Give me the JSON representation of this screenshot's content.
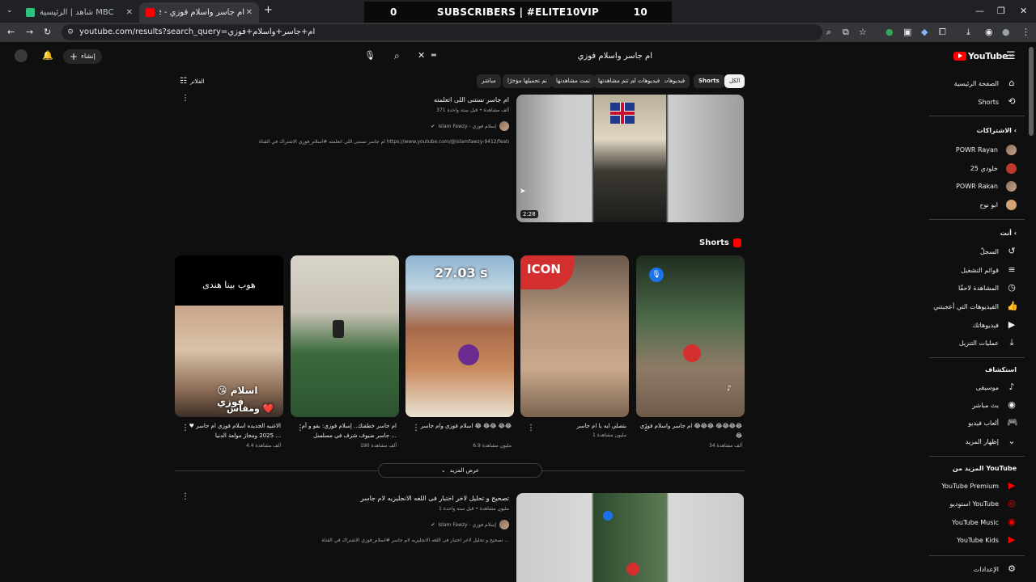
{
  "browser": {
    "tabs": [
      {
        "label": "شاهد | الرئيسية MBC",
        "active": false
      },
      {
        "label": "ام جاسر واسلام فوزي - YouTube",
        "active": true
      }
    ],
    "new_tab": "+",
    "overlay_banner": {
      "left_number": "0",
      "text": "SUBSCRIBERS | #ELITE10VIP",
      "right_number": "10"
    },
    "url": "youtube.com/results?search_query=ام+جاسر+واسلام+فوزي"
  },
  "masthead": {
    "logo_text": "YouTube",
    "logo_region": "SA",
    "search_value": "ام جاسر واسلام فوزي",
    "create_label": "إنشاء"
  },
  "sidebar": {
    "primary": [
      {
        "label": "الصفحة الرئيسية",
        "icon": "home-icon"
      },
      {
        "label": "Shorts",
        "icon": "shorts-icon"
      }
    ],
    "subscriptions_heading": "الاشتراكات",
    "subscriptions": [
      "POWR Rayan",
      "خلودي 25",
      "POWR Rakan",
      "ابو نوح"
    ],
    "you_heading": "أنت",
    "you_items": [
      {
        "label": "السجلّ",
        "icon": "history-icon"
      },
      {
        "label": "قوائم التشغيل",
        "icon": "playlist-icon"
      },
      {
        "label": "المشاهدة لاحقًا",
        "icon": "clock-icon"
      },
      {
        "label": "الفيديوهات التي أعجبتني",
        "icon": "like-icon"
      },
      {
        "label": "فيديوهاتك",
        "icon": "video-icon"
      },
      {
        "label": "عمليات التنزيل",
        "icon": "download-icon"
      }
    ],
    "explore_heading": "استكشاف",
    "explore_items": [
      {
        "label": "موسيقى",
        "icon": "music-icon"
      },
      {
        "label": "بث مباشر",
        "icon": "live-icon"
      },
      {
        "label": "ألعاب فيديو",
        "icon": "gaming-icon"
      },
      {
        "label": "إظهار المزيد",
        "icon": "chevron-down-icon"
      }
    ],
    "more_heading": "المزيد من YouTube",
    "more_items": [
      "YouTube Premium",
      "استوديو YouTube",
      "YouTube Music",
      "YouTube Kids"
    ],
    "settings_label": "الإعدادات"
  },
  "filters": {
    "label": "الفلاتر",
    "chips": [
      "الكل",
      "Shorts",
      "فيديوهات",
      "فيديوهات لم تتم مشاهدتها",
      "تمت مشاهدتها",
      "تم تحميلها مؤخرًا",
      "مباشر"
    ]
  },
  "video1": {
    "title": "ام جاسر نستنى اللى اتعلمته",
    "meta": "371 ألف مشاهدة • قبل سنة واحدة",
    "channel": "Islam Fawzy - إسلام فوزي",
    "description": "ام جاسر نستنى اللى اتعلمته #اسلام_فوزي الاشتراك في القناة https://www.youtube.com/@islamfawzy-9412/featured ...",
    "duration": "2:28"
  },
  "shorts_section": {
    "heading": "Shorts",
    "show_more": "عرض المزيد",
    "items": [
      {
        "title": "ام جاسر واسلام فوزي 😂😂😂 😂😂😂😂😂",
        "views": "34 ألف مشاهدة",
        "overlay": ""
      },
      {
        "title": "بتصلي ايه يا ام جاسر",
        "views": "1 مليون مشاهدة",
        "overlay": "ICON"
      },
      {
        "title": "اسلام فوزي وام جاسر 😂 😂😂 😂😂",
        "views": "6.9 مليون مشاهدة",
        "overlay": "27.03 s"
      },
      {
        "title": "ام جاسر خطفتك.. إسلام فوزي: بقو و أم جاسر ضيوف شرف في مسلسل ...",
        "views": "190 ألف مشاهدة",
        "overlay": ""
      },
      {
        "title": "الاغنيه الجديده اسلام فوزي ام جاسر ♥ 2025 ومجاز مولعة الدنيا ...",
        "views": "4.4 ألف مشاهدة",
        "overlay": "هوب بينا هندى",
        "overlay2": "😘 اسلام فوزي",
        "overlay3": "ومقاس ❤️"
      }
    ]
  },
  "video2": {
    "title": "تصحيح و تحليل لاخر اختبار فى اللغه الانجليزيه لام جاسر",
    "meta": "1 مليون مشاهدة • قبل سنة واحدة",
    "channel": "Islam Fawzy - إسلام فوزي",
    "description": "تصحيح و تحليل لاخر اختبار فى اللغه الانجليزيه لام جاسر #اسلام_فوزي الاشتراك في القناة ..."
  },
  "colors": {
    "bg": "#0f0f0f",
    "youtube_red": "#ff0000",
    "chip": "#272727"
  }
}
